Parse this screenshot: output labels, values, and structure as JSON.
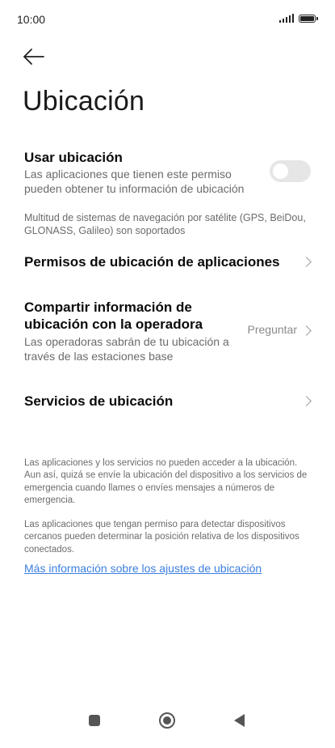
{
  "status_bar": {
    "time": "10:00",
    "icons": [
      "signal-icon",
      "battery-icon"
    ]
  },
  "header": {
    "back_icon": "arrow-left-icon",
    "title": "Ubicación"
  },
  "settings": {
    "use_location": {
      "title": "Usar ubicación",
      "description": "Las aplicaciones que tienen este permiso pueden obtener tu información de ubicación",
      "enabled": false
    },
    "gnss_note": "Multitud de sistemas de navegación por satélite (GPS, BeiDou, GLONASS, Galileo) son soportados",
    "app_permissions": {
      "title": "Permisos de ubicación de aplicaciones"
    },
    "share_with_carrier": {
      "title": "Compartir información de ubicación con la operadora",
      "description": "Las operadoras sabrán de tu ubicación a través de las estaciones base",
      "value": "Preguntar"
    },
    "location_services": {
      "title": "Servicios de ubicación"
    }
  },
  "footer": {
    "paragraph_1": "Las aplicaciones y los servicios no pueden acceder a la ubicación. Aun así, quizá se envíe la ubicación del dispositivo a los servicios de emergencia cuando llames o envíes mensajes a números de emergencia.",
    "paragraph_2": "Las aplicaciones que tengan permiso para detectar dispositivos cercanos pueden determinar la posición relativa de los dispositivos conectados.",
    "more_link": "Más información sobre los ajustes de ubicación"
  },
  "colors": {
    "link": "#3c7fe0",
    "toggle_off": "#e6e6e6",
    "secondary_text": "#6b6b6b"
  },
  "nav_bar": {
    "icons": [
      "recents-square-icon",
      "home-circle-icon",
      "back-triangle-icon"
    ]
  }
}
